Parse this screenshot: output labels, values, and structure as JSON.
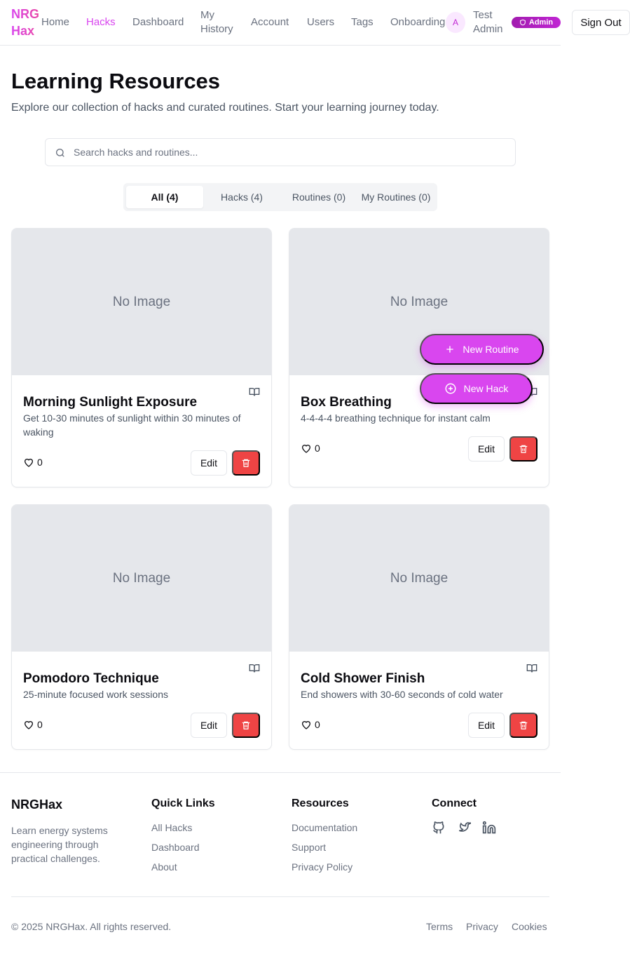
{
  "header": {
    "logo": "NRG Hax",
    "nav": [
      "Home",
      "Hacks",
      "Dashboard",
      "My History",
      "Account",
      "Users",
      "Tags",
      "Onboarding"
    ],
    "active_nav": "Hacks",
    "avatar_initial": "A",
    "user_name": "Test Admin",
    "admin_badge": "Admin",
    "sign_out": "Sign Out",
    "brand_color": "#d946ef"
  },
  "hero": {
    "title": "Learning Resources",
    "subtitle": "Explore our collection of hacks and curated routines. Start your learning journey today."
  },
  "search": {
    "placeholder": "Search hacks and routines...",
    "value": ""
  },
  "tabs": [
    {
      "label": "All (4)",
      "active": true
    },
    {
      "label": "Hacks (4)",
      "active": false
    },
    {
      "label": "Routines (0)",
      "active": false
    },
    {
      "label": "My Routines (0)",
      "active": false
    }
  ],
  "cards": [
    {
      "image_text": "No Image",
      "title": "Morning Sunlight Exposure",
      "description": "Get 10-30 minutes of sunlight within 30 minutes of waking",
      "likes": "0",
      "edit": "Edit"
    },
    {
      "image_text": "No Image",
      "title": "Box Breathing",
      "description": "4-4-4-4 breathing technique for instant calm",
      "likes": "0",
      "edit": "Edit"
    },
    {
      "image_text": "No Image",
      "title": "Pomodoro Technique",
      "description": "25-minute focused work sessions",
      "likes": "0",
      "edit": "Edit"
    },
    {
      "image_text": "No Image",
      "title": "Cold Shower Finish",
      "description": "End showers with 30-60 seconds of cold water",
      "likes": "0",
      "edit": "Edit"
    }
  ],
  "fab": {
    "new_routine": "New Routine",
    "new_hack": "New Hack"
  },
  "footer": {
    "brand": "NRGHax",
    "tagline": "Learn energy systems engineering through practical challenges.",
    "quick_links": {
      "heading": "Quick Links",
      "links": [
        "All Hacks",
        "Dashboard",
        "About"
      ]
    },
    "resources": {
      "heading": "Resources",
      "links": [
        "Documentation",
        "Support",
        "Privacy Policy"
      ]
    },
    "connect": {
      "heading": "Connect",
      "icons": [
        "github-icon",
        "twitter-icon",
        "linkedin-icon"
      ]
    },
    "copyright": "© 2025 NRGHax. All rights reserved.",
    "legal": [
      "Terms",
      "Privacy",
      "Cookies"
    ]
  },
  "colors": {
    "danger": "#ef4444",
    "accent": "#d946ef",
    "muted": "#6b7280"
  }
}
